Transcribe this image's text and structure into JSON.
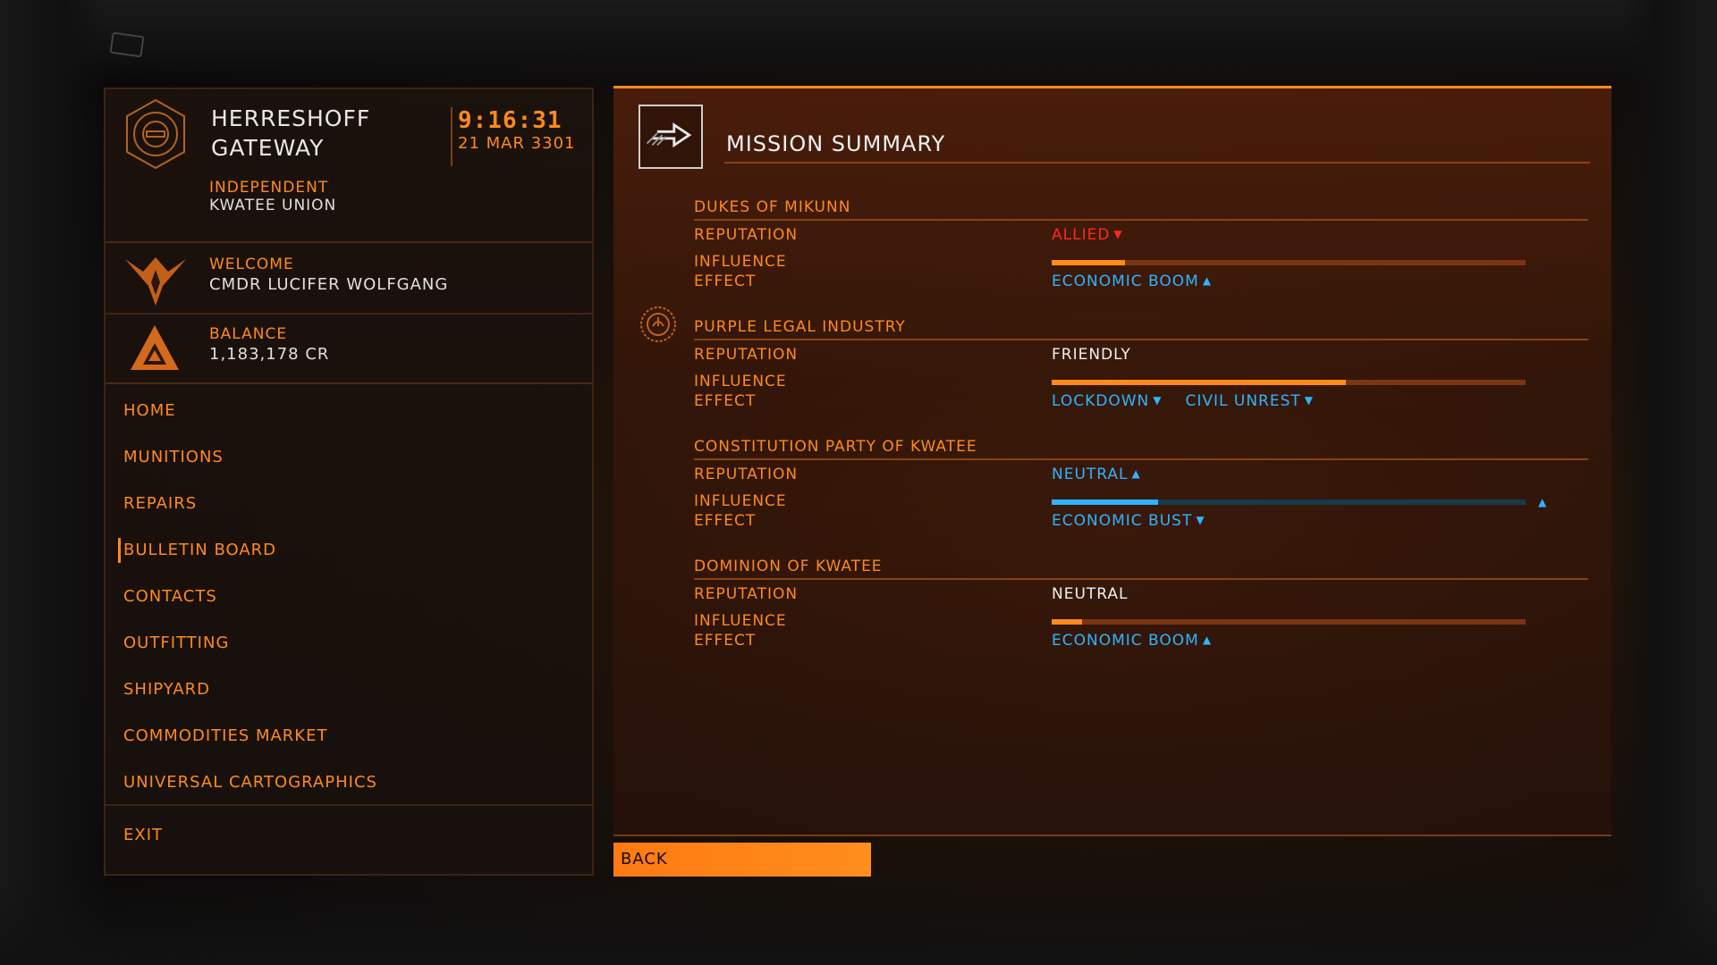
{
  "station": {
    "name_line1": "HERRESHOFF",
    "name_line2": "GATEWAY",
    "time": "9:16:31",
    "date": "21 MAR 3301",
    "allegiance": "INDEPENDENT",
    "faction": "KWATEE UNION"
  },
  "commander": {
    "welcome_label": "WELCOME",
    "name": "CMDR LUCIFER WOLFGANG"
  },
  "balance": {
    "label": "BALANCE",
    "value": "1,183,178 CR"
  },
  "menu": {
    "items": [
      {
        "label": "HOME"
      },
      {
        "label": "MUNITIONS"
      },
      {
        "label": "REPAIRS"
      },
      {
        "label": "BULLETIN BOARD",
        "selected": true
      },
      {
        "label": "CONTACTS"
      },
      {
        "label": "OUTFITTING"
      },
      {
        "label": "SHIPYARD"
      },
      {
        "label": "COMMODITIES MARKET"
      },
      {
        "label": "UNIVERSAL CARTOGRAPHICS"
      }
    ],
    "exit_label": "EXIT"
  },
  "mission": {
    "title": "MISSION SUMMARY",
    "row_labels": {
      "reputation": "REPUTATION",
      "influence": "INFLUENCE",
      "effect": "EFFECT"
    },
    "factions": [
      {
        "name": "DUKES OF MIKUNN",
        "reputation": "ALLIED",
        "reputation_color": "red",
        "reputation_arrow": "▼",
        "influence_fraction": 0.155,
        "influence_color": "orange",
        "effects": [
          {
            "label": "ECONOMIC BOOM",
            "arrow": "▲"
          }
        ]
      },
      {
        "name": "PURPLE LEGAL INDUSTRY",
        "reputation": "FRIENDLY",
        "reputation_color": "white",
        "reputation_arrow": "",
        "influence_fraction": 0.62,
        "influence_color": "orange",
        "effects": [
          {
            "label": "LOCKDOWN",
            "arrow": "▼"
          },
          {
            "label": "CIVIL UNREST",
            "arrow": "▼"
          }
        ]
      },
      {
        "name": "CONSTITUTION PARTY OF KWATEE",
        "reputation": "NEUTRAL",
        "reputation_color": "blue",
        "reputation_arrow": "▲",
        "influence_fraction": 0.225,
        "influence_color": "blue",
        "influence_marker": "▲",
        "effects": [
          {
            "label": "ECONOMIC BUST",
            "arrow": "▼"
          }
        ]
      },
      {
        "name": "DOMINION OF KWATEE",
        "reputation": "NEUTRAL",
        "reputation_color": "white",
        "reputation_arrow": "",
        "influence_fraction": 0.065,
        "influence_color": "orange",
        "effects": [
          {
            "label": "ECONOMIC BOOM",
            "arrow": "▲"
          }
        ]
      }
    ]
  },
  "back_label": "BACK",
  "colors": {
    "accent": "#ff8a1e",
    "allied": "#ff2a1a",
    "positive": "#2fb4ff",
    "text": "#f0f0f0"
  }
}
